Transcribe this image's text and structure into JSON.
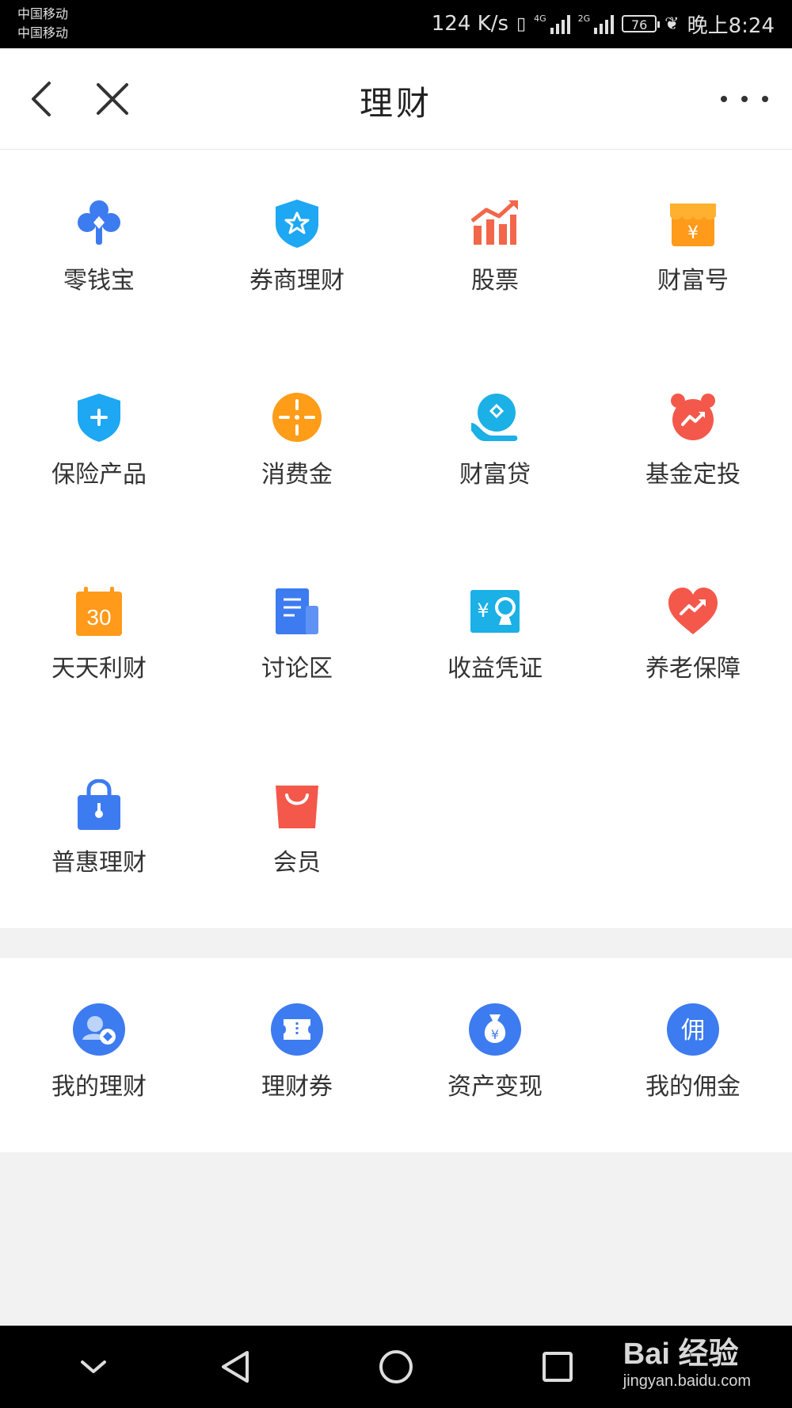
{
  "status_bar": {
    "carrier1": "中国移动",
    "carrier2": "中国移动",
    "speed": "124 K/s",
    "net1": "4G",
    "net2": "2G",
    "battery": "76",
    "time": "晚上8:24"
  },
  "nav": {
    "title": "理财"
  },
  "main_items": [
    {
      "label": "零钱宝",
      "icon": "clover-icon",
      "color": "#3d7bf0"
    },
    {
      "label": "券商理财",
      "icon": "shield-star-icon",
      "color": "#1ea7f2"
    },
    {
      "label": "股票",
      "icon": "stock-chart-icon",
      "color": "#f2664a"
    },
    {
      "label": "财富号",
      "icon": "shop-icon",
      "color": "#ff9a1a"
    },
    {
      "label": "保险产品",
      "icon": "shield-plus-icon",
      "color": "#1ea7f2"
    },
    {
      "label": "消费金",
      "icon": "crosshair-coin-icon",
      "color": "#ff9c18"
    },
    {
      "label": "财富贷",
      "icon": "hand-coin-icon",
      "color": "#1bb0e6"
    },
    {
      "label": "基金定投",
      "icon": "alarm-clock-icon",
      "color": "#f4584b"
    },
    {
      "label": "天天利财",
      "icon": "calendar-30-icon",
      "color": "#ff9a1a"
    },
    {
      "label": "讨论区",
      "icon": "document-icon",
      "color": "#3d7bf0"
    },
    {
      "label": "收益凭证",
      "icon": "certificate-icon",
      "color": "#1bb0e6"
    },
    {
      "label": "养老保障",
      "icon": "heart-trend-icon",
      "color": "#f4584b"
    },
    {
      "label": "普惠理财",
      "icon": "lock-bag-icon",
      "color": "#3d7bf0"
    },
    {
      "label": "会员",
      "icon": "shopping-bag-icon",
      "color": "#f4584b"
    }
  ],
  "my_items": [
    {
      "label": "我的理财",
      "icon": "my-finance-icon",
      "color": "#3d7bf0"
    },
    {
      "label": "理财券",
      "icon": "ticket-icon",
      "color": "#3d7bf0"
    },
    {
      "label": "资产变现",
      "icon": "money-bag-icon",
      "color": "#3d7bf0"
    },
    {
      "label": "我的佣金",
      "icon": "commission-icon",
      "color": "#3d7bf0",
      "glyph": "佣"
    }
  ],
  "money_glyph": "¥",
  "calendar_day": "30",
  "watermark": {
    "brand": "Bai 经验",
    "url": "jingyan.baidu.com"
  }
}
